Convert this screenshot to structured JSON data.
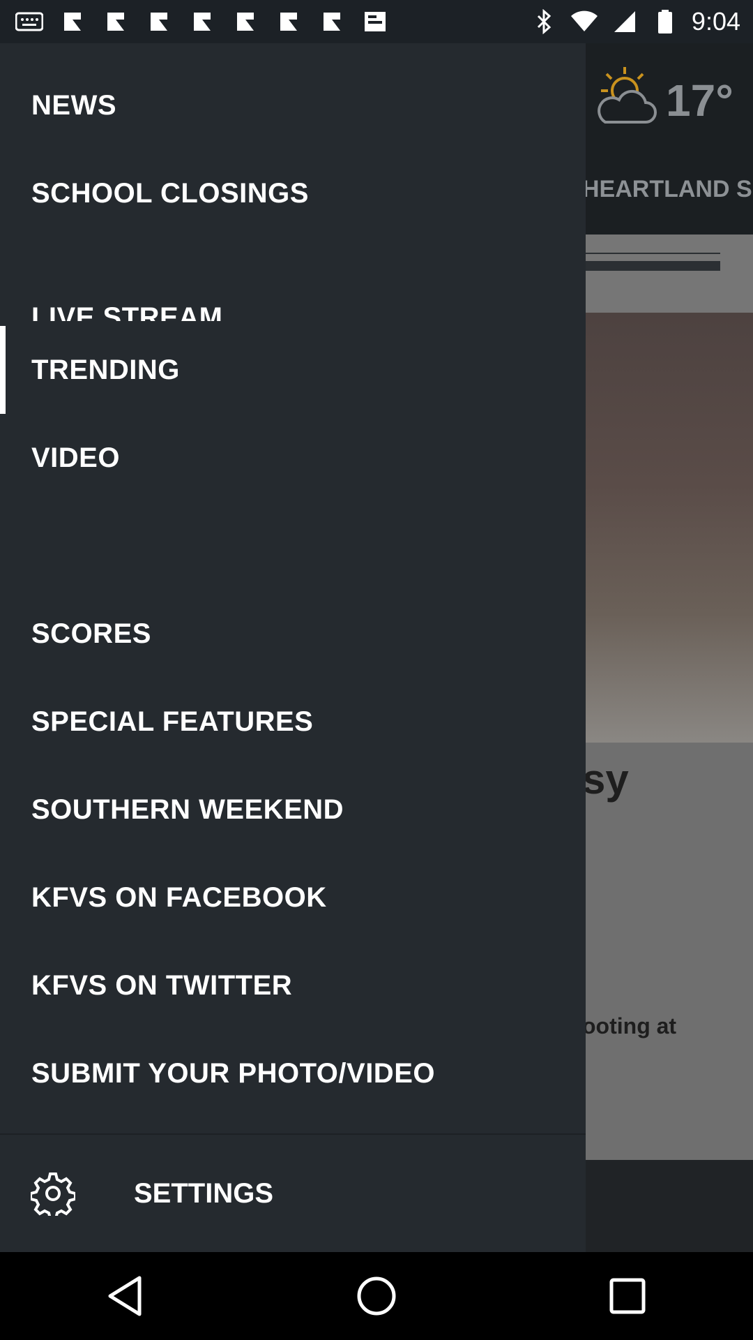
{
  "status_bar": {
    "time": "9:04",
    "left_icons": [
      "notification-icon",
      "image-icon",
      "image-icon",
      "image-icon",
      "image-icon",
      "image-icon",
      "image-icon",
      "image-icon",
      "clipboard-icon"
    ],
    "right_icons": [
      "bluetooth-icon",
      "wifi-icon",
      "signal-icon",
      "battery-icon"
    ]
  },
  "background_app": {
    "temperature": "17°",
    "weather_icon": "partly-cloudy-icon",
    "section_tab": "HEARTLAND S",
    "headline_fragment": "sy",
    "text_fragment": "ooting at"
  },
  "drawer": {
    "items": [
      {
        "label": "NEWS",
        "active": false
      },
      {
        "label": "SCHOOL CLOSINGS",
        "active": false
      },
      {
        "label": "LIVE STREAM",
        "active": false
      },
      {
        "label": "TRENDING",
        "active": true
      },
      {
        "label": "VIDEO",
        "active": false
      },
      {
        "label": "SCORES",
        "active": false
      },
      {
        "label": "SPECIAL FEATURES",
        "active": false
      },
      {
        "label": "SOUTHERN WEEKEND",
        "active": false
      },
      {
        "label": "KFVS ON FACEBOOK",
        "active": false
      },
      {
        "label": "KFVS ON TWITTER",
        "active": false
      },
      {
        "label": "SUBMIT YOUR PHOTO/VIDEO",
        "active": false
      }
    ],
    "settings_label": "SETTINGS",
    "settings_icon": "gear-icon"
  },
  "nav_bar": {
    "buttons": [
      "back-icon",
      "home-icon",
      "recents-icon"
    ]
  },
  "colors": {
    "drawer_bg": "#252a2f",
    "header_bg": "#1b1f22",
    "text": "#ffffff"
  }
}
